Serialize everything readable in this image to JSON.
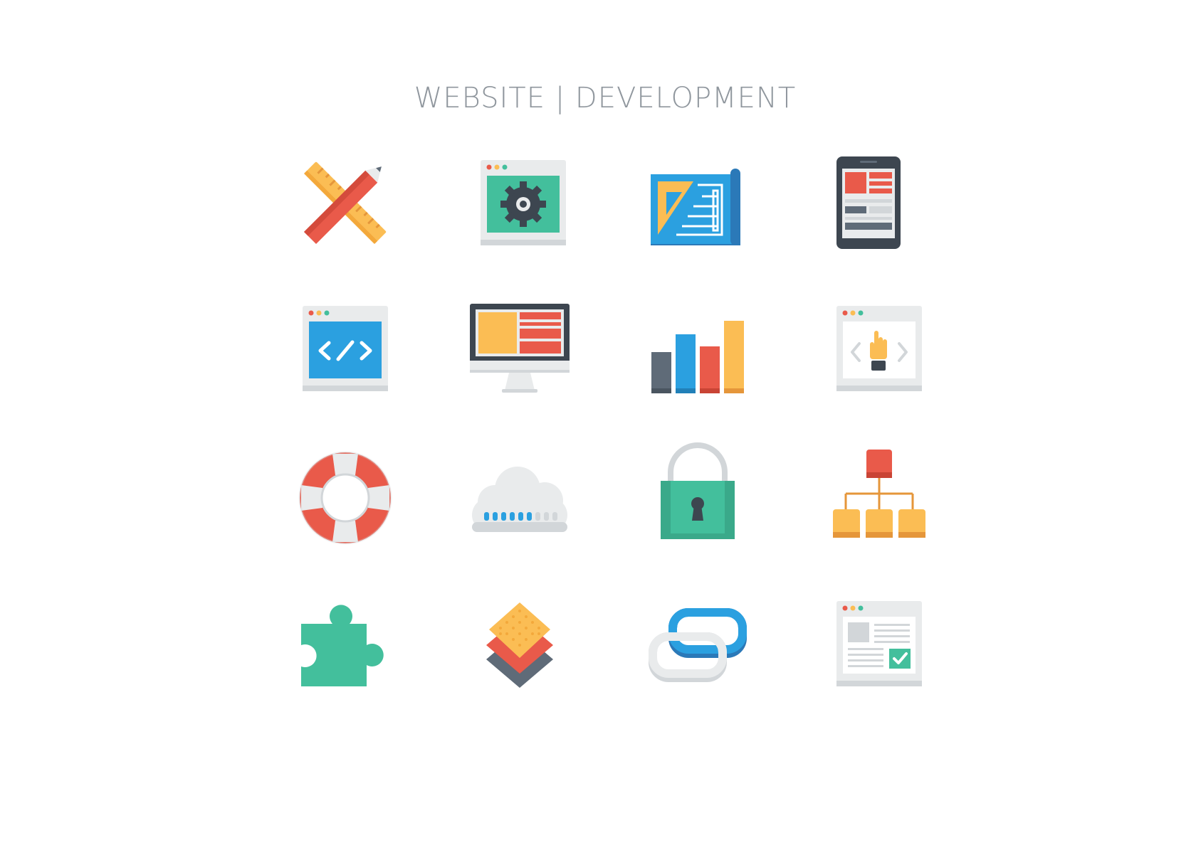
{
  "page": {
    "title": "WEBSITE | DEVELOPMENT"
  },
  "icons": [
    "pencil-ruler-icon",
    "browser-settings-icon",
    "blueprint-icon",
    "tablet-layout-icon",
    "browser-code-icon",
    "desktop-monitor-icon",
    "bar-chart-icon",
    "browser-touch-icon",
    "lifebuoy-icon",
    "cloud-storage-icon",
    "padlock-icon",
    "sitemap-icon",
    "puzzle-piece-icon",
    "layers-icon",
    "link-icon",
    "browser-checklist-icon"
  ],
  "colors": {
    "red": "#e95a4a",
    "yellow": "#fbbd54",
    "green": "#43bf9c",
    "blue": "#2ba0e0",
    "slate": "#5f6b78",
    "light_gray": "#e9ebec",
    "title_gray": "#8f969d"
  }
}
